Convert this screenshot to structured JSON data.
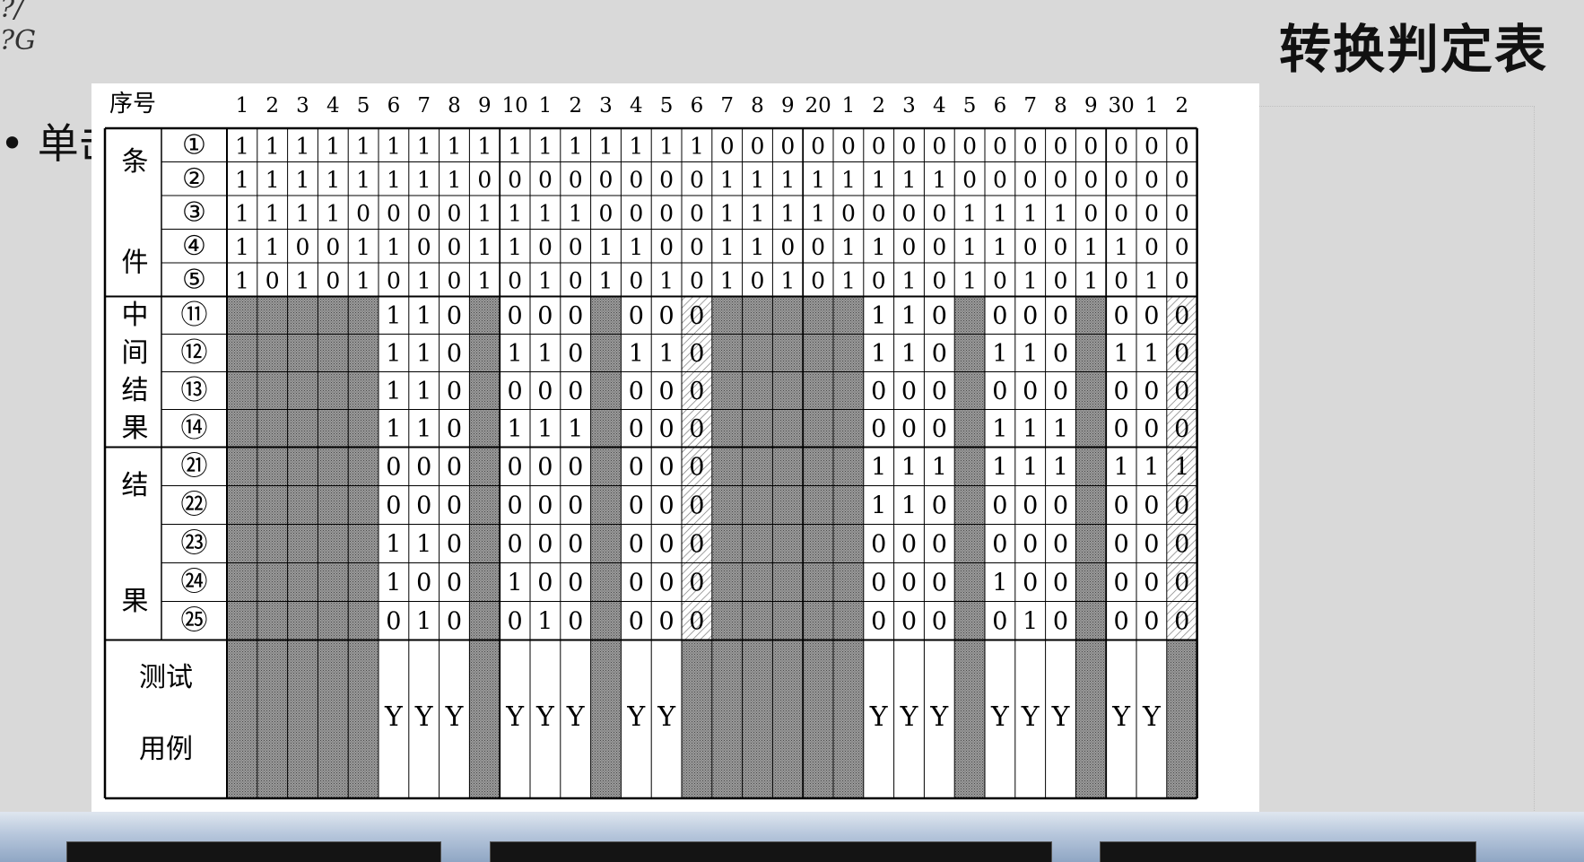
{
  "slide": {
    "title": "转换判定表",
    "corner_text": [
      "?/",
      "?G"
    ],
    "bullet_text": "• 单击"
  },
  "table": {
    "header_label": "序号",
    "column_numbers": [
      "1",
      "2",
      "3",
      "4",
      "5",
      "6",
      "7",
      "8",
      "9",
      "10",
      "1",
      "2",
      "3",
      "4",
      "5",
      "6",
      "7",
      "8",
      "9",
      "20",
      "1",
      "2",
      "3",
      "4",
      "5",
      "6",
      "7",
      "8",
      "9",
      "30",
      "1",
      "2"
    ],
    "groups": [
      {
        "label": "条件",
        "rows": [
          "①",
          "②",
          "③",
          "④",
          "⑤"
        ]
      },
      {
        "label": "中间结果",
        "rows": [
          "⑪",
          "⑫",
          "⑬",
          "⑭"
        ]
      },
      {
        "label": "结果",
        "rows": [
          "㉑",
          "㉒",
          "㉓",
          "㉔",
          "㉕"
        ]
      }
    ],
    "conditions": [
      [
        "1",
        "1",
        "1",
        "1",
        "1",
        "1",
        "1",
        "1",
        "1",
        "1",
        "1",
        "1",
        "1",
        "1",
        "1",
        "1",
        "0",
        "0",
        "0",
        "0",
        "0",
        "0",
        "0",
        "0",
        "0",
        "0",
        "0",
        "0",
        "0",
        "0",
        "0",
        "0"
      ],
      [
        "1",
        "1",
        "1",
        "1",
        "1",
        "1",
        "1",
        "1",
        "0",
        "0",
        "0",
        "0",
        "0",
        "0",
        "0",
        "0",
        "1",
        "1",
        "1",
        "1",
        "1",
        "1",
        "1",
        "1",
        "0",
        "0",
        "0",
        "0",
        "0",
        "0",
        "0",
        "0"
      ],
      [
        "1",
        "1",
        "1",
        "1",
        "0",
        "0",
        "0",
        "0",
        "1",
        "1",
        "1",
        "1",
        "0",
        "0",
        "0",
        "0",
        "1",
        "1",
        "1",
        "1",
        "0",
        "0",
        "0",
        "0",
        "1",
        "1",
        "1",
        "1",
        "0",
        "0",
        "0",
        "0"
      ],
      [
        "1",
        "1",
        "0",
        "0",
        "1",
        "1",
        "0",
        "0",
        "1",
        "1",
        "0",
        "0",
        "1",
        "1",
        "0",
        "0",
        "1",
        "1",
        "0",
        "0",
        "1",
        "1",
        "0",
        "0",
        "1",
        "1",
        "0",
        "0",
        "1",
        "1",
        "0",
        "0"
      ],
      [
        "1",
        "0",
        "1",
        "0",
        "1",
        "0",
        "1",
        "0",
        "1",
        "0",
        "1",
        "0",
        "1",
        "0",
        "1",
        "0",
        "1",
        "0",
        "1",
        "0",
        "1",
        "0",
        "1",
        "0",
        "1",
        "0",
        "1",
        "0",
        "1",
        "0",
        "1",
        "0"
      ]
    ],
    "intermediate": [
      [
        "",
        "",
        "",
        "",
        "",
        "1",
        "1",
        "0",
        "",
        "0",
        "0",
        "0",
        "",
        "0",
        "0",
        "0",
        "",
        "",
        "",
        "",
        "",
        "1",
        "1",
        "0",
        "",
        "0",
        "0",
        "0",
        "",
        "0",
        "0",
        "0"
      ],
      [
        "",
        "",
        "",
        "",
        "",
        "1",
        "1",
        "0",
        "",
        "1",
        "1",
        "0",
        "",
        "1",
        "1",
        "0",
        "",
        "",
        "",
        "",
        "",
        "1",
        "1",
        "0",
        "",
        "1",
        "1",
        "0",
        "",
        "1",
        "1",
        "0"
      ],
      [
        "",
        "",
        "",
        "",
        "",
        "1",
        "1",
        "0",
        "",
        "0",
        "0",
        "0",
        "",
        "0",
        "0",
        "0",
        "",
        "",
        "",
        "",
        "",
        "0",
        "0",
        "0",
        "",
        "0",
        "0",
        "0",
        "",
        "0",
        "0",
        "0"
      ],
      [
        "",
        "",
        "",
        "",
        "",
        "1",
        "1",
        "0",
        "",
        "1",
        "1",
        "1",
        "",
        "0",
        "0",
        "0",
        "",
        "",
        "",
        "",
        "",
        "0",
        "0",
        "0",
        "",
        "1",
        "1",
        "1",
        "",
        "0",
        "0",
        "0"
      ]
    ],
    "results": [
      [
        "",
        "",
        "",
        "",
        "",
        "0",
        "0",
        "0",
        "",
        "0",
        "0",
        "0",
        "",
        "0",
        "0",
        "0",
        "",
        "",
        "",
        "",
        "",
        "1",
        "1",
        "1",
        "",
        "1",
        "1",
        "1",
        "",
        "1",
        "1",
        "1"
      ],
      [
        "",
        "",
        "",
        "",
        "",
        "0",
        "0",
        "0",
        "",
        "0",
        "0",
        "0",
        "",
        "0",
        "0",
        "0",
        "",
        "",
        "",
        "",
        "",
        "1",
        "1",
        "0",
        "",
        "0",
        "0",
        "0",
        "",
        "0",
        "0",
        "0"
      ],
      [
        "",
        "",
        "",
        "",
        "",
        "1",
        "1",
        "0",
        "",
        "0",
        "0",
        "0",
        "",
        "0",
        "0",
        "0",
        "",
        "",
        "",
        "",
        "",
        "0",
        "0",
        "0",
        "",
        "0",
        "0",
        "0",
        "",
        "0",
        "0",
        "0"
      ],
      [
        "",
        "",
        "",
        "",
        "",
        "1",
        "0",
        "0",
        "",
        "1",
        "0",
        "0",
        "",
        "0",
        "0",
        "0",
        "",
        "",
        "",
        "",
        "",
        "0",
        "0",
        "0",
        "",
        "1",
        "0",
        "0",
        "",
        "0",
        "0",
        "0"
      ],
      [
        "",
        "",
        "",
        "",
        "",
        "0",
        "1",
        "0",
        "",
        "0",
        "1",
        "0",
        "",
        "0",
        "0",
        "0",
        "",
        "",
        "",
        "",
        "",
        "0",
        "0",
        "0",
        "",
        "0",
        "1",
        "0",
        "",
        "0",
        "0",
        "0"
      ]
    ],
    "test_label": [
      "测试",
      "用例"
    ],
    "test_cases": [
      "",
      "",
      "",
      "",
      "",
      "Y",
      "Y",
      "Y",
      "",
      "Y",
      "Y",
      "Y",
      "",
      "Y",
      "Y",
      "",
      "",
      "",
      "",
      "",
      "",
      "Y",
      "Y",
      "Y",
      "",
      "Y",
      "Y",
      "Y",
      "",
      "Y",
      "Y",
      ""
    ],
    "shaded_columns": [
      1,
      2,
      3,
      4,
      5,
      9,
      13,
      17,
      18,
      19,
      20,
      21,
      25,
      29
    ],
    "hatched_columns": [
      16,
      32
    ]
  },
  "colors": {
    "slide_background": "#d9d9d9",
    "table_background": "#ffffff",
    "shade": "#8a8a8a",
    "grid": "#000000"
  }
}
